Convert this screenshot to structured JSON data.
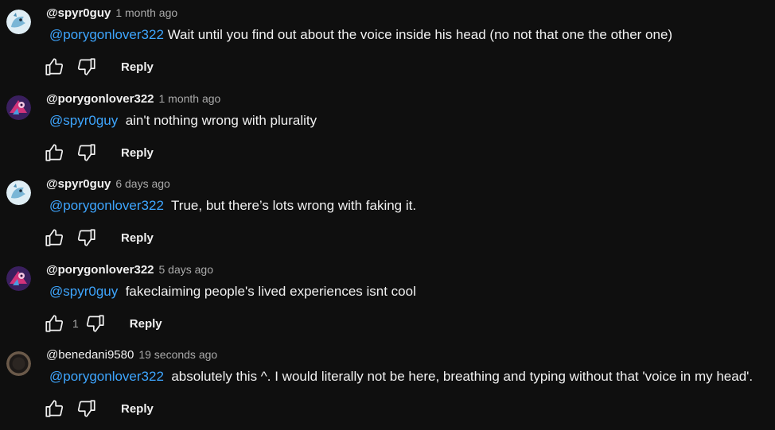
{
  "comments": [
    {
      "author": "@spyr0guy",
      "time": "1 month ago",
      "mention": "@porygonlover322",
      "text": " Wait until you find out about the voice inside his head (no not that one the other one)",
      "likes": "",
      "reply_label": "Reply",
      "avatar": "spyro-avatar"
    },
    {
      "author": "@porygonlover322",
      "time": "1 month ago",
      "mention": "@spyr0guy",
      "text": "  ain't nothing wrong with plurality",
      "likes": "",
      "reply_label": "Reply",
      "avatar": "porygon-avatar"
    },
    {
      "author": "@spyr0guy",
      "time": "6 days ago",
      "mention": "@porygonlover322",
      "text": "  True, but there’s lots wrong with faking it.",
      "likes": "",
      "reply_label": "Reply",
      "avatar": "spyro-avatar"
    },
    {
      "author": "@porygonlover322",
      "time": "5 days ago",
      "mention": "@spyr0guy",
      "text": "  fakeclaiming people's lived experiences isnt cool",
      "likes": "1",
      "reply_label": "Reply",
      "avatar": "porygon-avatar"
    },
    {
      "author": "@benedani9580",
      "time": "19 seconds ago",
      "mention": "@porygonlover322",
      "text": "  absolutely this ^. I would literally not be here, breathing and typing without that 'voice in my head'.",
      "likes": "",
      "reply_label": "Reply",
      "avatar": "bene-avatar"
    }
  ],
  "colors": {
    "background": "#0f0f0f",
    "text": "#f1f1f1",
    "secondary": "#aaaaaa",
    "mention": "#3ea6ff"
  },
  "icons": [
    "thumbs-up-icon",
    "thumbs-down-icon"
  ]
}
